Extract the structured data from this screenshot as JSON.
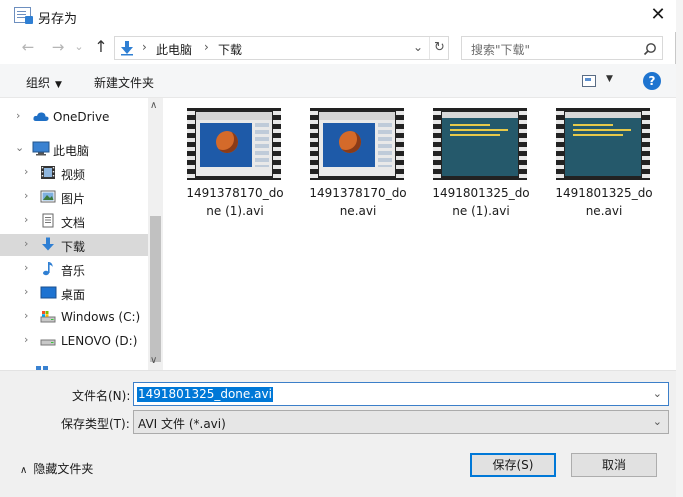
{
  "window": {
    "title": "另存为",
    "close_glyph": "✕"
  },
  "nav": {
    "back_glyph": "←",
    "forward_glyph": "→",
    "recent_glyph": "⌄",
    "up_glyph": "↑",
    "address": {
      "crumbs": [
        "此电脑",
        "下载"
      ],
      "separator": "›",
      "dropdown_glyph": "⌄",
      "refresh_glyph": "↻"
    },
    "search": {
      "placeholder": "搜索\"下载\""
    }
  },
  "toolbar": {
    "organize_label": "组织",
    "organize_caret": "▼",
    "new_folder_label": "新建文件夹",
    "view_caret": "▼",
    "help_label": "?"
  },
  "sidebar": {
    "scroll_up": "∧",
    "scroll_down": "∨",
    "items": [
      {
        "label": "OneDrive",
        "icon": "cloud-icon",
        "chevron": "›"
      },
      {
        "label": "此电脑",
        "icon": "computer-icon",
        "chevron": "⌄"
      },
      {
        "label": "视频",
        "icon": "video-folder-icon",
        "chevron": "›"
      },
      {
        "label": "图片",
        "icon": "pictures-folder-icon",
        "chevron": "›"
      },
      {
        "label": "文档",
        "icon": "documents-folder-icon",
        "chevron": "›"
      },
      {
        "label": "下载",
        "icon": "download-folder-icon",
        "chevron": "›",
        "selected": true
      },
      {
        "label": "音乐",
        "icon": "music-folder-icon",
        "chevron": "›"
      },
      {
        "label": "桌面",
        "icon": "desktop-folder-icon",
        "chevron": "›"
      },
      {
        "label": "Windows (C:)",
        "icon": "system-drive-icon",
        "chevron": "›"
      },
      {
        "label": "LENOVO (D:)",
        "icon": "drive-icon",
        "chevron": "›"
      }
    ]
  },
  "files": [
    {
      "name": "1491378170_done (1).avi",
      "thumb": "browser"
    },
    {
      "name": "1491378170_done.avi",
      "thumb": "browser"
    },
    {
      "name": "1491801325_done (1).avi",
      "thumb": "teal"
    },
    {
      "name": "1491801325_done.avi",
      "thumb": "teal"
    }
  ],
  "form": {
    "filename_label": "文件名(N):",
    "filename_value": "1491801325_done.avi",
    "filetype_label": "保存类型(T):",
    "filetype_value": "AVI 文件 (*.avi)",
    "dropdown_glyph": "⌄"
  },
  "footer": {
    "hide_folders_label": "隐藏文件夹",
    "hide_caret": "∧",
    "save_label": "保存(S)",
    "cancel_label": "取消"
  }
}
